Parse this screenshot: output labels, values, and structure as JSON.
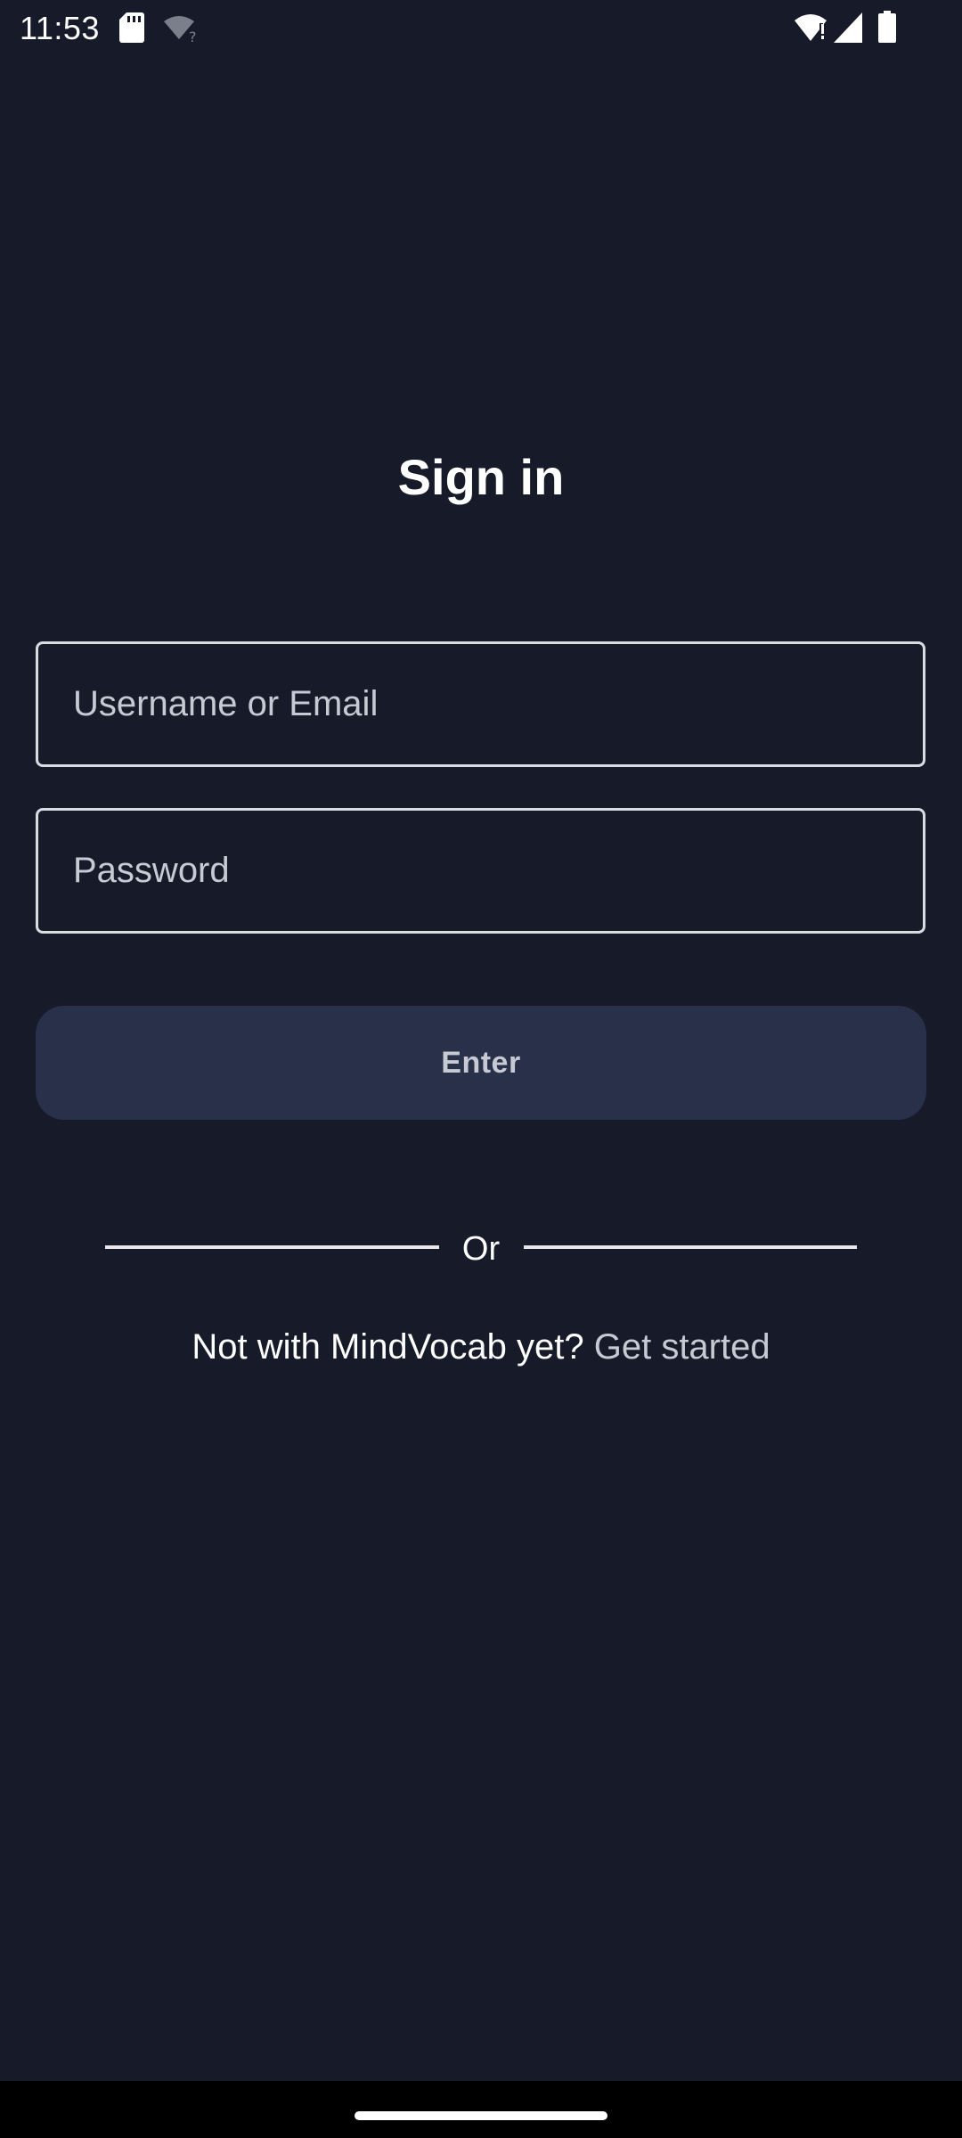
{
  "status_bar": {
    "time": "11:53",
    "icons": [
      "sd-card-icon",
      "wifi-off-icon",
      "wifi-alert-icon",
      "signal-icon",
      "battery-icon"
    ]
  },
  "title": "Sign in",
  "form": {
    "username_placeholder": "Username or Email",
    "username_value": "",
    "password_placeholder": "Password",
    "password_value": "",
    "submit_label": "Enter"
  },
  "divider_text": "Or",
  "signup": {
    "prompt": "Not with MindVocab yet?",
    "link": "Get started"
  },
  "colors": {
    "background": "#171b29",
    "button_background": "#283149",
    "muted_text": "#c8cad3",
    "border": "#d9dbe2"
  }
}
